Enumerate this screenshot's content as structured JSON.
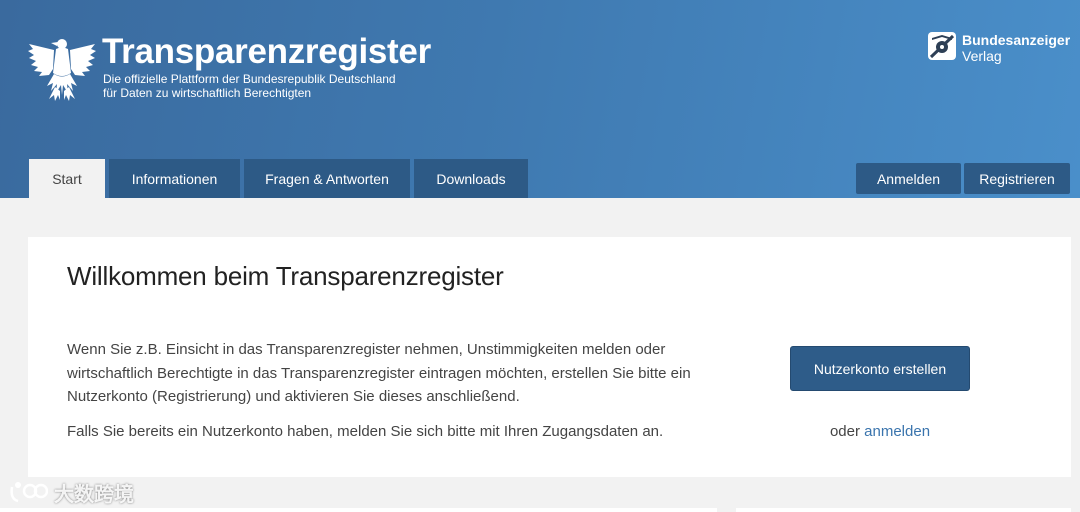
{
  "header": {
    "title": "Transparenzregister",
    "subtitle_line1": "Die offizielle Plattform der Bundesrepublik Deutschland",
    "subtitle_line2": "für Daten zu wirtschaftlich Berechtigten",
    "publisher_name": "Bundesanzeiger",
    "publisher_sub": "Verlag"
  },
  "nav": {
    "tabs": [
      {
        "label": "Start",
        "active": true
      },
      {
        "label": "Informationen",
        "active": false
      },
      {
        "label": "Fragen & Antworten",
        "active": false
      },
      {
        "label": "Downloads",
        "active": false
      }
    ],
    "login_label": "Anmelden",
    "register_label": "Registrieren"
  },
  "welcome": {
    "title": "Willkommen beim Transparenzregister",
    "intro": "Wenn Sie z.B. Einsicht in das Transparenzregister nehmen, Unstimmigkeiten melden oder wirtschaftlich Berechtigte in das Transparenzregister eintragen möchten, erstellen Sie bitte ein Nutzerkonto (Registrierung) und aktivieren Sie dieses anschließend.",
    "note": "Falls Sie bereits ein Nutzerkonto haben, melden Sie sich bitte mit Ihren Zugangsdaten an.",
    "cta_label": "Nutzerkonto erstellen",
    "or_text": "oder",
    "login_link": "anmelden"
  },
  "watermark": {
    "text": "大数跨境"
  },
  "colors": {
    "header_start": "#3a6a9e",
    "header_end": "#4a8fca",
    "nav_tab": "#2d5a86",
    "button": "#2e5c89",
    "link": "#3a74ad",
    "page_bg": "#f2f2f2"
  },
  "icons": {
    "eagle": "federal-eagle-icon",
    "publisher": "bundesanzeiger-logo-icon"
  }
}
